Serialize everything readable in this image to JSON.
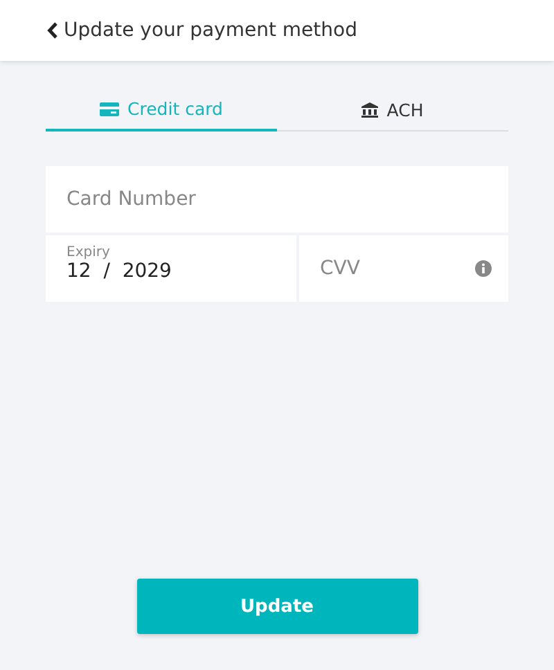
{
  "header": {
    "title": "Update your payment method"
  },
  "tabs": [
    {
      "label": "Credit card",
      "kind": "card",
      "selected": true
    },
    {
      "label": "ACH",
      "kind": "bank",
      "selected": false
    }
  ],
  "form": {
    "card_number": {
      "placeholder": "Card Number"
    },
    "expiry": {
      "label": "Expiry",
      "value": "12  /  2029"
    },
    "cvv": {
      "placeholder": "CVV"
    }
  },
  "button": "Update"
}
